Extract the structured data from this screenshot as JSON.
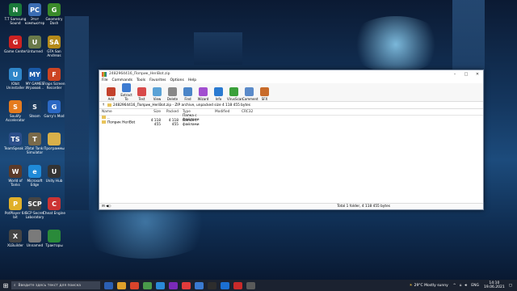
{
  "desktop": {
    "icons": [
      {
        "label": "T.T Samsung Sound",
        "color": "#1a7a3a",
        "glyph": "N"
      },
      {
        "label": "Этот компьютер",
        "color": "#3b6db3",
        "glyph": "PC"
      },
      {
        "label": "Geometry Dash",
        "color": "#3a8a2a",
        "glyph": "G"
      },
      {
        "label": "Game Center",
        "color": "#c22",
        "glyph": "G"
      },
      {
        "label": "Unturned",
        "color": "#6a7a4a",
        "glyph": "U"
      },
      {
        "label": "GTA San Andreas",
        "color": "#b48a1a",
        "glyph": "SA"
      },
      {
        "label": "IObit Uninstaller",
        "color": "#2f86c9",
        "glyph": "U"
      },
      {
        "label": "MY GAMES Игровой...",
        "color": "#1a5aa8",
        "glyph": "MY"
      },
      {
        "label": "Fraps Screen Recorder",
        "color": "#c42",
        "glyph": "F"
      },
      {
        "label": "Soulify Accelerator",
        "color": "#e57b1e",
        "glyph": "S"
      },
      {
        "label": "Steam",
        "color": "#1b3a5c",
        "glyph": "S"
      },
      {
        "label": "Garry's Mod",
        "color": "#2b68c4",
        "glyph": "G"
      },
      {
        "label": "TeamSpeak 3",
        "color": "#2c4f8a",
        "glyph": "TS"
      },
      {
        "label": "Total Tank Simulator",
        "color": "#7a6a4a",
        "glyph": "T"
      },
      {
        "label": "Программы",
        "color": "#d8b04a",
        "glyph": ""
      },
      {
        "label": "World of Tanks",
        "color": "#5a3a2a",
        "glyph": "W"
      },
      {
        "label": "Microsoft Edge",
        "color": "#1f8ad8",
        "glyph": "e"
      },
      {
        "label": "Unity Hub",
        "color": "#333",
        "glyph": "U"
      },
      {
        "label": "PotPlayer 64 bit",
        "color": "#e0b02a",
        "glyph": "P"
      },
      {
        "label": "SCP Secret Laboratory",
        "color": "#444",
        "glyph": "SCP"
      },
      {
        "label": "Cheat Engine",
        "color": "#c33",
        "glyph": "C"
      },
      {
        "label": "XLBuilder",
        "color": "#444",
        "glyph": "X"
      },
      {
        "label": "Unnamed",
        "color": "#7a7a7a",
        "glyph": ""
      },
      {
        "label": "Тракторы",
        "color": "#2a8a3a",
        "glyph": ""
      }
    ]
  },
  "window": {
    "title": "2482964416_Поприк_HeriBot.zip",
    "controls": [
      "–",
      "□",
      "✕"
    ],
    "menu": [
      "File",
      "Commands",
      "Tools",
      "Favorites",
      "Options",
      "Help"
    ],
    "toolbar": [
      {
        "label": "Add",
        "color": "#c3412b",
        "icon": "add-icon"
      },
      {
        "label": "Extract To",
        "color": "#3d7bd1",
        "icon": "extract-icon"
      },
      {
        "label": "Test",
        "color": "#d84a4a",
        "icon": "test-icon"
      },
      {
        "label": "View",
        "color": "#5aa2d6",
        "icon": "view-icon"
      },
      {
        "label": "Delete",
        "color": "#888",
        "icon": "delete-icon"
      },
      {
        "label": "Find",
        "color": "#4b85c8",
        "icon": "find-icon"
      },
      {
        "label": "Wizard",
        "color": "#a24fd0",
        "icon": "wizard-icon"
      },
      {
        "label": "Info",
        "color": "#2a7ad1",
        "icon": "info-icon"
      },
      {
        "label": "VirusScan",
        "color": "#3aa03a",
        "icon": "virusscan-icon"
      },
      {
        "label": "Comment",
        "color": "#5a8ac9",
        "icon": "comment-icon"
      },
      {
        "label": "SFX",
        "color": "#c86b2a",
        "icon": "sfx-icon"
      }
    ],
    "address": "2482964416_Поприк_HeriBot.zip - ZIP archive, unpacked size 4 118 455 bytes",
    "columns": [
      "Name",
      "Size",
      "Packed",
      "Type",
      "Modified",
      "CRC32"
    ],
    "rows": [
      {
        "name": "..",
        "size": "",
        "packed": "",
        "type": "Папка с файлами",
        "modified": "",
        "crc": ""
      },
      {
        "name": "Поприк HeriBot",
        "size": "4 118 455",
        "packed": "4 118 455",
        "type": "Папка с файлами",
        "modified": "",
        "crc": ""
      }
    ],
    "status_left": "⊟ ◀◇",
    "status_right": "Total 1 folder, 4 118 455 bytes"
  },
  "taskbar": {
    "search_placeholder": "Введите здесь текст для поиска",
    "apps": [
      "#2b5fb3",
      "#e0a12a",
      "#d9442b",
      "#4a9a4a",
      "#2a8ad8",
      "#7a2ab8",
      "#e23b3b",
      "#3a7ad1",
      "#2d2d2d",
      "#1b6fd1",
      "#c92a2a",
      "#5a5a5a"
    ],
    "weather": "29°C  Mostly sunny",
    "time": "14:10",
    "date": "19.06.2021",
    "lang": "ENG"
  }
}
